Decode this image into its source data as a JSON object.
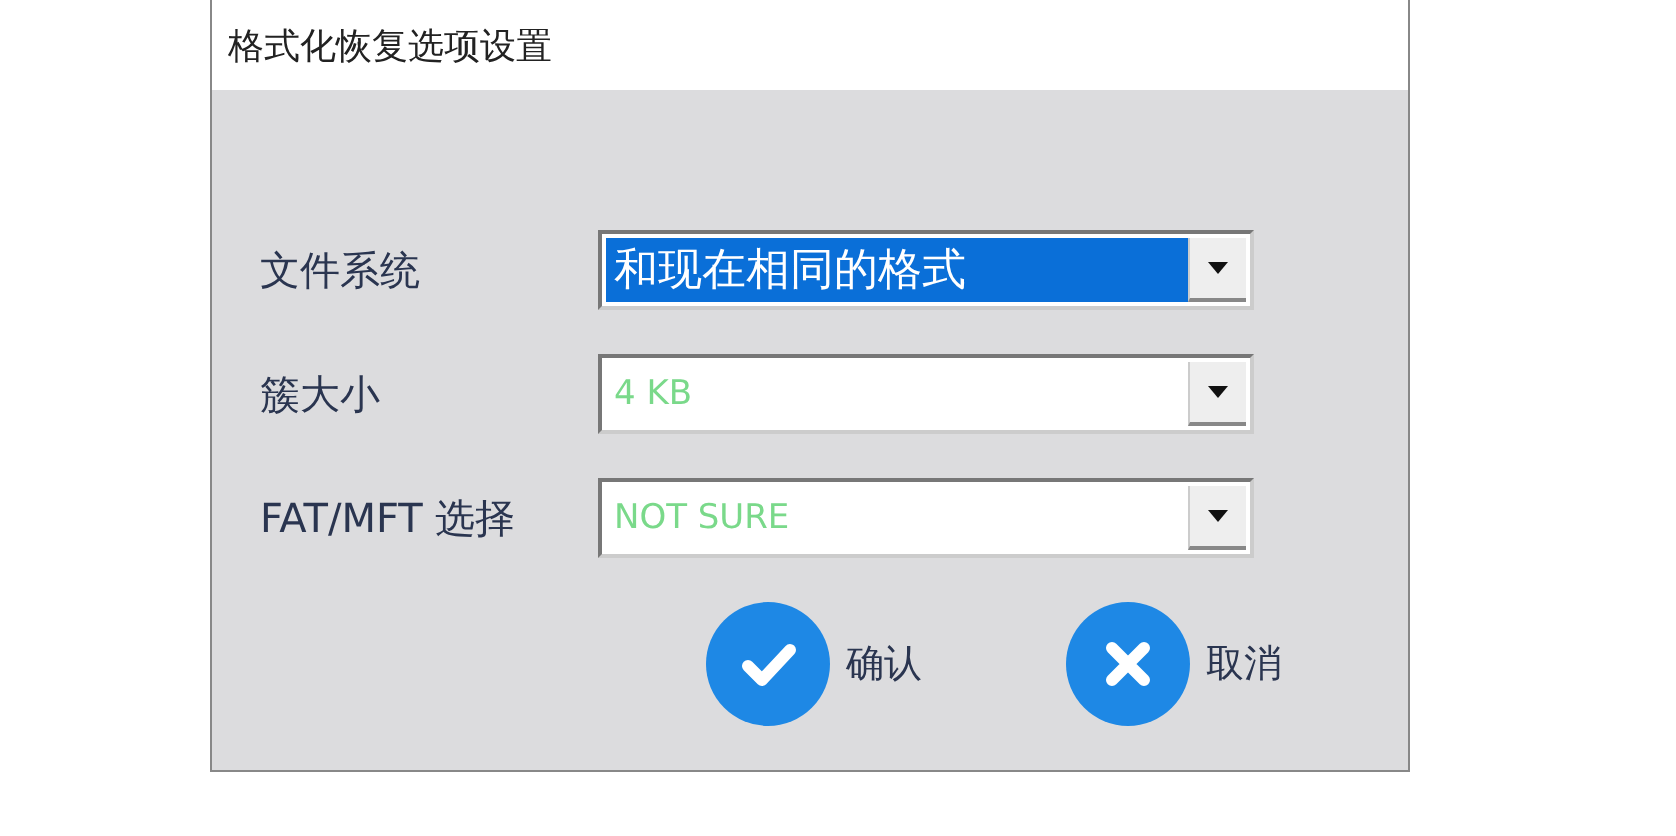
{
  "window": {
    "title": "格式化恢复选项设置"
  },
  "fields": [
    {
      "label": "文件系统",
      "value": "和现在相同的格式",
      "highlighted": true
    },
    {
      "label": "簇大小",
      "value": "4 KB",
      "highlighted": false
    },
    {
      "label": "FAT/MFT 选择",
      "value": "NOT SURE",
      "highlighted": false
    }
  ],
  "buttons": [
    {
      "kind": "confirm",
      "label": "确认"
    },
    {
      "kind": "cancel",
      "label": "取消"
    }
  ]
}
